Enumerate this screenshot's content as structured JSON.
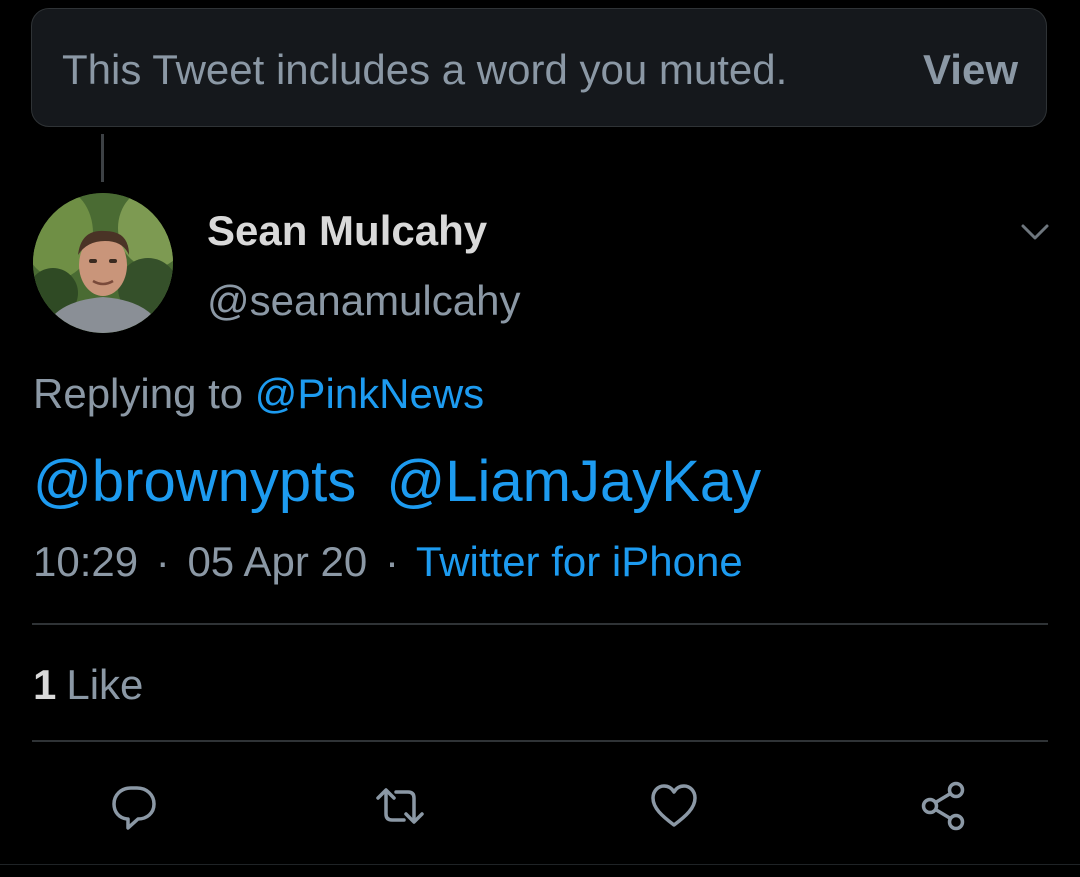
{
  "muted_notice": {
    "text": "This Tweet includes a word you muted.",
    "view_label": "View"
  },
  "author": {
    "display_name": "Sean Mulcahy",
    "handle": "@seanamulcahy"
  },
  "reply_context": {
    "prefix": "Replying to",
    "handle": "@PinkNews"
  },
  "tweet": {
    "mentions": [
      "@brownypts",
      "@LiamJayKay"
    ]
  },
  "meta": {
    "time": "10:29",
    "separator": "·",
    "date": "05 Apr 20",
    "source": "Twitter for iPhone"
  },
  "stats": {
    "likes_count": "1",
    "likes_label": "Like"
  },
  "icons": {
    "menu": "chevron-down-icon",
    "reply": "reply-icon",
    "retweet": "retweet-icon",
    "like": "heart-icon",
    "share": "share-icon"
  },
  "colors": {
    "background": "#000000",
    "link": "#1d9bf0",
    "secondary_text": "#8b98a5",
    "primary_text": "#d9d9d9",
    "border": "#2f3336"
  }
}
